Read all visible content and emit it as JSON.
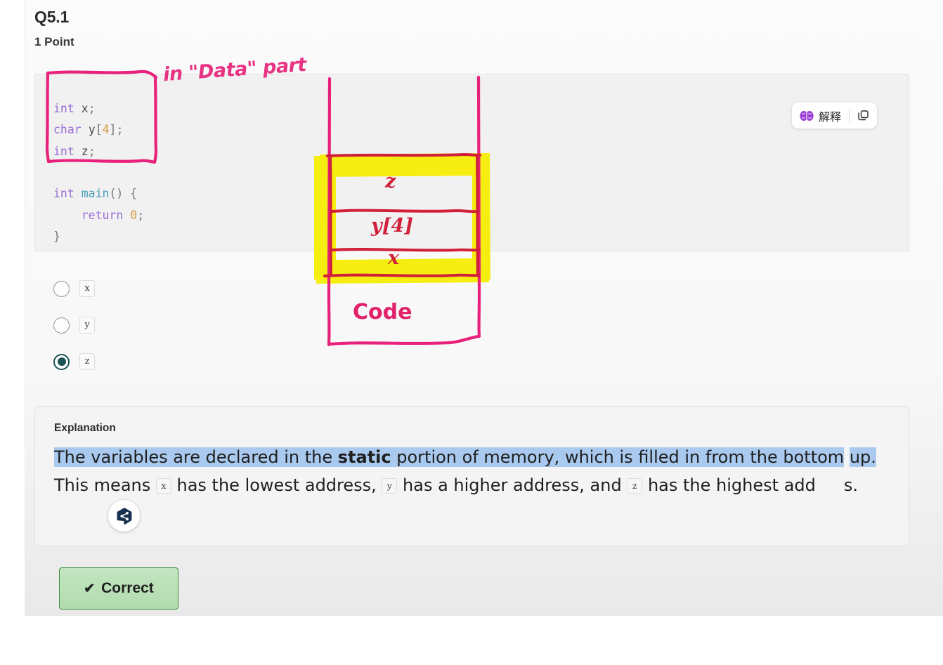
{
  "question": {
    "title": "Q5.1",
    "points": "1 Point"
  },
  "code": {
    "lines": [
      [
        {
          "t": "int",
          "c": "kw"
        },
        {
          "t": " ",
          "c": "pun"
        },
        {
          "t": "x",
          "c": "id"
        },
        {
          "t": ";",
          "c": "pun"
        }
      ],
      [
        {
          "t": "char",
          "c": "kw"
        },
        {
          "t": " ",
          "c": "pun"
        },
        {
          "t": "y",
          "c": "id"
        },
        {
          "t": "[",
          "c": "pun"
        },
        {
          "t": "4",
          "c": "num"
        },
        {
          "t": "]",
          "c": "pun"
        },
        {
          "t": ";",
          "c": "pun"
        }
      ],
      [
        {
          "t": "int",
          "c": "kw"
        },
        {
          "t": " ",
          "c": "pun"
        },
        {
          "t": "z",
          "c": "id"
        },
        {
          "t": ";",
          "c": "pun"
        }
      ],
      [],
      [
        {
          "t": "int",
          "c": "kw"
        },
        {
          "t": " ",
          "c": "pun"
        },
        {
          "t": "main",
          "c": "fn"
        },
        {
          "t": "() {",
          "c": "pun"
        }
      ],
      [
        {
          "t": "    ",
          "c": "pun"
        },
        {
          "t": "return",
          "c": "kw"
        },
        {
          "t": " ",
          "c": "pun"
        },
        {
          "t": "0",
          "c": "num"
        },
        {
          "t": ";",
          "c": "pun"
        }
      ],
      [
        {
          "t": "}",
          "c": "pun"
        }
      ]
    ],
    "plain": "int x;\nchar y[4];\nint z;\n\nint main() {\n    return 0;\n}"
  },
  "ai_toolbar": {
    "explain_label": "解释",
    "brain_icon": "brain-icon",
    "copy_icon": "copy-icon",
    "accent_color": "#8b3fd1"
  },
  "options": [
    {
      "label": "x",
      "selected": false
    },
    {
      "label": "y",
      "selected": false
    },
    {
      "label": "z",
      "selected": true
    }
  ],
  "explanation": {
    "title": "Explanation",
    "full_text": "The variables are declared in the static portion of memory, which is filled in from the bottom up. This means x has the lowest address, y has a higher address, and z has the highest address.",
    "segment_1": "The variables are declared in the ",
    "segment_bold": "static",
    "segment_2": " portion of memory, which is filled in from the bottom",
    "segment_3": "up.",
    "segment_4": " This means ",
    "chip_x": "x",
    "segment_5": " has the lowest address, ",
    "chip_y": "y",
    "segment_6": " has a higher address, and ",
    "chip_z": "z",
    "segment_7": " has the highest",
    "segment_8": "add",
    "segment_9": "s.",
    "highlight_color": "#a9c9ee"
  },
  "badge": {
    "icon": "share-node-badge-icon",
    "color": "#18314f"
  },
  "status": {
    "label": "Correct",
    "check_icon": "check-icon",
    "background": "#b8e0b5",
    "border": "#3d8b3d"
  },
  "annotation": {
    "note": "in \"Data\" part",
    "ink_color": "#e83283",
    "cell_ink_color": "#d11f3a",
    "highlight_color": "#f6ee10",
    "cells": [
      {
        "label": "z"
      },
      {
        "label": "y[4]"
      },
      {
        "label": "x"
      },
      {
        "label": "Code"
      }
    ]
  }
}
